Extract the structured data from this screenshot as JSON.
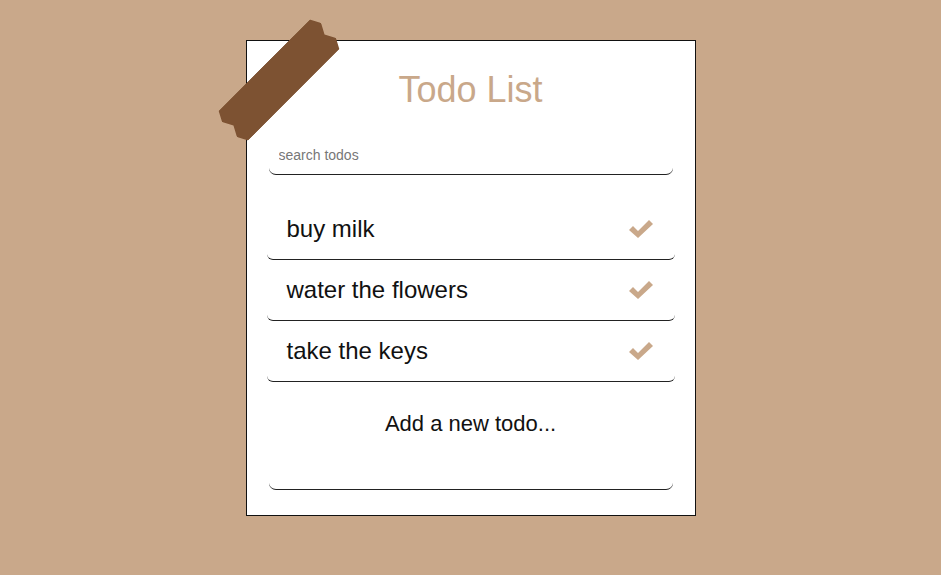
{
  "title": "Todo List",
  "search": {
    "placeholder": "search todos"
  },
  "todos": [
    {
      "text": "buy milk"
    },
    {
      "text": "water the flowers"
    },
    {
      "text": "take the keys"
    }
  ],
  "add": {
    "label": "Add a new todo...",
    "value": ""
  }
}
